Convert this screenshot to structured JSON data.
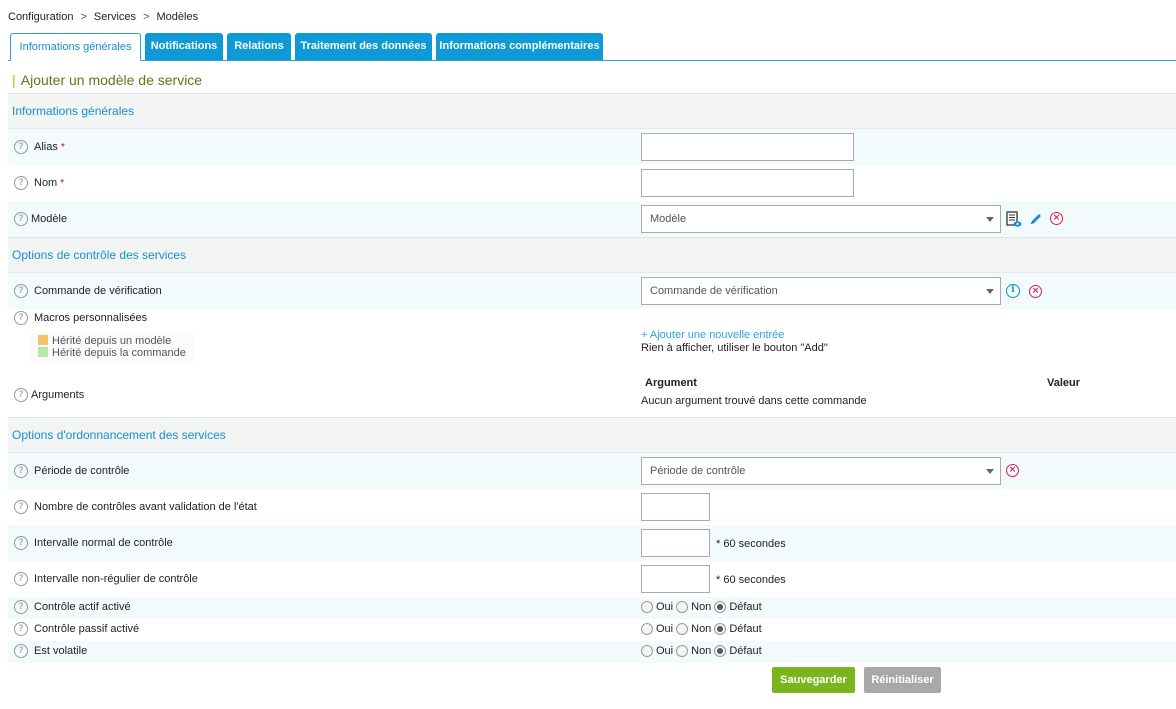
{
  "breadcrumb": [
    "Configuration",
    "Services",
    "Modèles"
  ],
  "breadcrumb_sep": ">",
  "tabs": [
    "Informations générales",
    "Notifications",
    "Relations",
    "Traitement des données",
    "Informations complémentaires"
  ],
  "page_title": "Ajouter un modèle de service",
  "sections": {
    "general": "Informations générales",
    "check": "Options de contrôle des services",
    "sched": "Options d'ordonnancement des services"
  },
  "fields": {
    "alias": "Alias",
    "nom": "Nom",
    "required_mark": "*",
    "modele": "Modèle",
    "modele_placeholder": "Modèle",
    "commande": "Commande de vérification",
    "commande_placeholder": "Commande de vérification",
    "macros": "Macros personnalisées",
    "legend_template": "Hérité depuis un modèle",
    "legend_command": "Hérité depuis la commande",
    "add_entry": "+ Ajouter une nouvelle entrée",
    "empty_macros": "Rien à afficher, utiliser le bouton \"Add\"",
    "arguments": "Arguments",
    "arg_col": "Argument",
    "val_col": "Valeur",
    "no_args": "Aucun argument trouvé dans cette commande",
    "periode": "Période de contrôle",
    "periode_placeholder": "Période de contrôle",
    "max_checks": "Nombre de contrôles avant validation de l'état",
    "normal_interval": "Intervalle normal de contrôle",
    "retry_interval": "Intervalle non-régulier de contrôle",
    "unit": "* 60 secondes",
    "active_checks": "Contrôle actif activé",
    "passive_checks": "Contrôle passif activé",
    "volatile": "Est volatile"
  },
  "radio": {
    "yes": "Oui",
    "no": "Non",
    "default": "Défaut",
    "selected": "default"
  },
  "buttons": {
    "save": "Sauvegarder",
    "reset": "Réinitialiser"
  },
  "colors": {
    "tab_blue": "#0e9ad7",
    "section_text": "#1391d0",
    "title_green": "#5a7a18",
    "save_green": "#7ab51d",
    "reset_gray": "#a8a8a8",
    "legend_template": "#f5c36b",
    "legend_command": "#b5e8a4",
    "remove_red": "#d6204d"
  },
  "icons": {
    "help": "question-circle-icon",
    "remove": "remove-circle-icon",
    "info": "info-circle-icon",
    "view": "view-document-icon",
    "edit": "pencil-icon"
  }
}
